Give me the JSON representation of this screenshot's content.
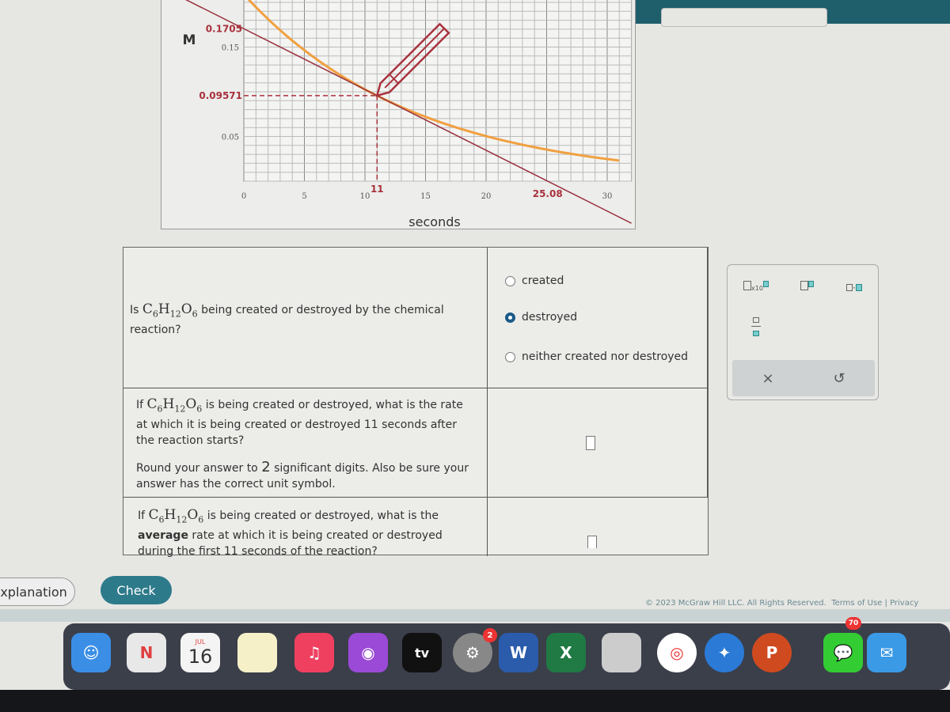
{
  "chart_data": {
    "type": "line",
    "xlabel": "seconds",
    "ylabel": "M",
    "xlim": [
      0,
      32
    ],
    "ylim": [
      0,
      0.2
    ],
    "x_ticks": [
      "0",
      "5",
      "10",
      "15",
      "20",
      "30"
    ],
    "y_ticks": [
      "0.05",
      "0.15"
    ],
    "grid": true,
    "series": [
      {
        "type": "curve",
        "color": "#f0a040",
        "x": [
          0,
          5,
          11,
          15,
          20,
          25,
          31
        ],
        "y": [
          0.209,
          0.146,
          0.0957,
          0.072,
          0.05,
          0.035,
          0.023
        ]
      },
      {
        "type": "tangent",
        "color": "#9a3340",
        "x": [
          0,
          25.08
        ],
        "y": [
          0.1705,
          0
        ]
      }
    ],
    "annotations": [
      {
        "text": "0.1705",
        "x": 0,
        "y": 0.1705
      },
      {
        "text": "0.09571",
        "x": 0,
        "y": 0.09571
      },
      {
        "text": "11",
        "x": 11,
        "y": 0
      },
      {
        "text": "25.08",
        "x": 25.08,
        "y": 0
      }
    ],
    "highlight_color": "#a8323c"
  },
  "q1": {
    "prefix": "Is ",
    "suffix": " being created or destroyed by the chemical reaction?",
    "options": [
      {
        "label": "created",
        "selected": false
      },
      {
        "label": "destroyed",
        "selected": true
      },
      {
        "label": "neither created nor destroyed",
        "selected": false
      }
    ]
  },
  "q2": {
    "prefix": "If ",
    "suffix": " is being created or destroyed, what is the rate at which it is being created or destroyed 11 seconds after the reaction starts?",
    "round_a": "Round your answer to ",
    "digits": "2",
    "round_b": " significant digits. Also be sure your answer has the correct unit symbol.",
    "answer": ""
  },
  "q3": {
    "prefix": "If ",
    "suffix": " is being created or destroyed, what is the",
    "bold": "average",
    "rest": " rate at which it is being created or destroyed during the first 11 seconds of the reaction?",
    "answer": ""
  },
  "chem": {
    "C": "C",
    "c6": "6",
    "H": "H",
    "h12": "12",
    "O": "O",
    "o6": "6"
  },
  "tools": {
    "x10": "x10",
    "clear": "×",
    "undo": "↺"
  },
  "buttons": {
    "explanation": "Explanation",
    "check": "Check"
  },
  "footer": {
    "copyright": "© 2023 McGraw Hill LLC. All Rights Reserved.",
    "terms": "Terms of Use",
    "privacy": "Privacy"
  },
  "dock": {
    "calendar_month": "JUL",
    "calendar_day": "16",
    "tv": "tv",
    "word": "W",
    "excel": "X",
    "ppt": "P",
    "settings_badge": "2",
    "messages_badge": "70"
  }
}
